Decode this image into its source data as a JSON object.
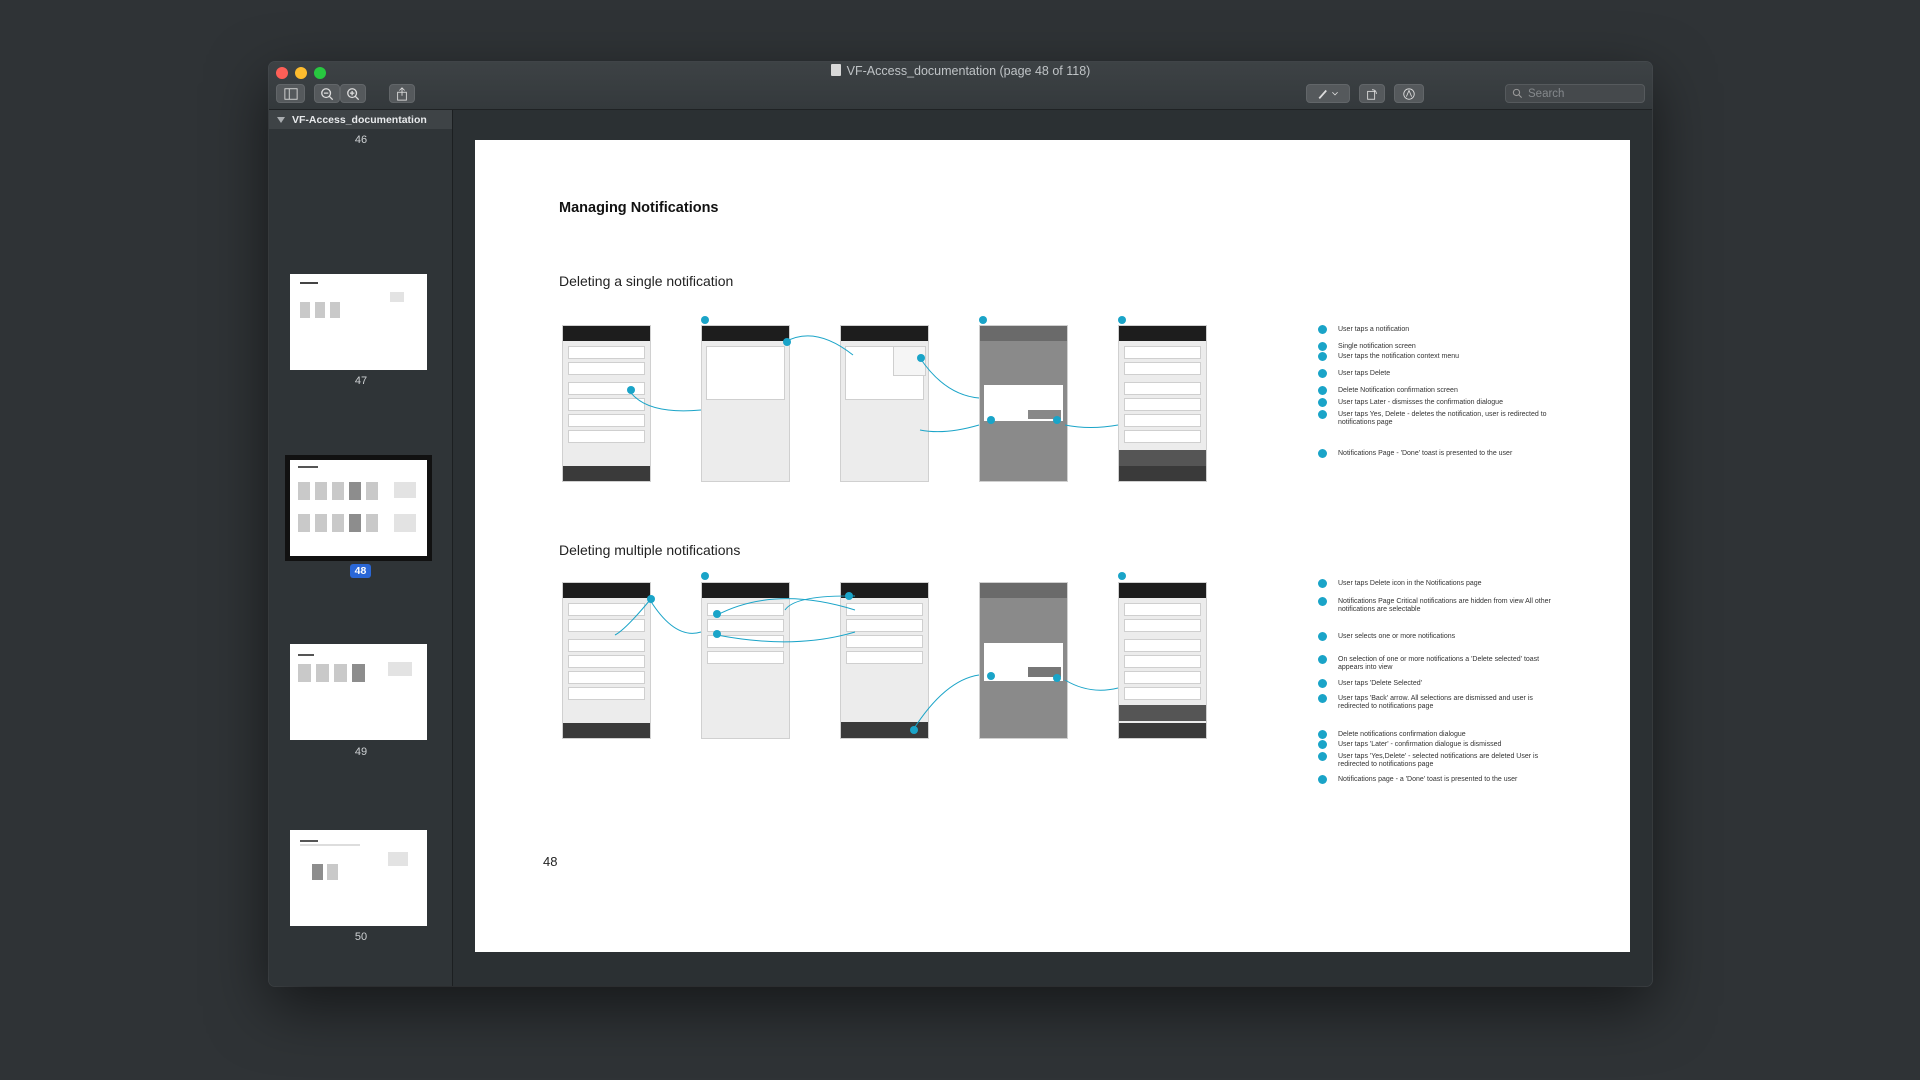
{
  "window": {
    "title": "VF-Access_documentation (page 48 of 118)",
    "search_placeholder": "Search"
  },
  "sidebar": {
    "header": "VF-Access_documentation",
    "pages": [
      {
        "label": "46"
      },
      {
        "label": "47"
      },
      {
        "label": "48",
        "selected": true
      },
      {
        "label": "49"
      },
      {
        "label": "50"
      }
    ]
  },
  "page": {
    "title": "Managing Notifications",
    "section1": "Deleting a single notification",
    "section2": "Deleting multiple notifications",
    "page_number": "48",
    "legend1": [
      "User taps a notification",
      "Single notification screen",
      "User taps the notification context menu",
      "User taps Delete",
      "Delete Notification confirmation screen",
      "User taps Later - dismisses the confirmation dialogue",
      "User taps Yes, Delete - deletes the notification, user is redirected to notifications page",
      "Notifications Page - 'Done' toast is presented to the user"
    ],
    "legend2": [
      "User taps Delete icon in the Notifications page",
      "Notifications Page Critical notifications are hidden from view All other notifications are selectable",
      "User selects one or more notifications",
      "On selection of one or more notifications a 'Delete selected' toast appears into view",
      "User taps 'Delete Selected'",
      "User taps 'Back' arrow. All selections are dismissed and user is redirected to notifications page",
      "Delete notifications confirmation dialogue",
      "User taps 'Later' - confirmation dialogue is dismissed",
      "User taps 'Yes,Delete' - selected notifications are deleted User is redirected to notifications page",
      "Notifications page - a 'Done' toast is presented to the user"
    ]
  },
  "colors": {
    "accent": "#1aa4c8",
    "selection": "#2a67d6"
  }
}
